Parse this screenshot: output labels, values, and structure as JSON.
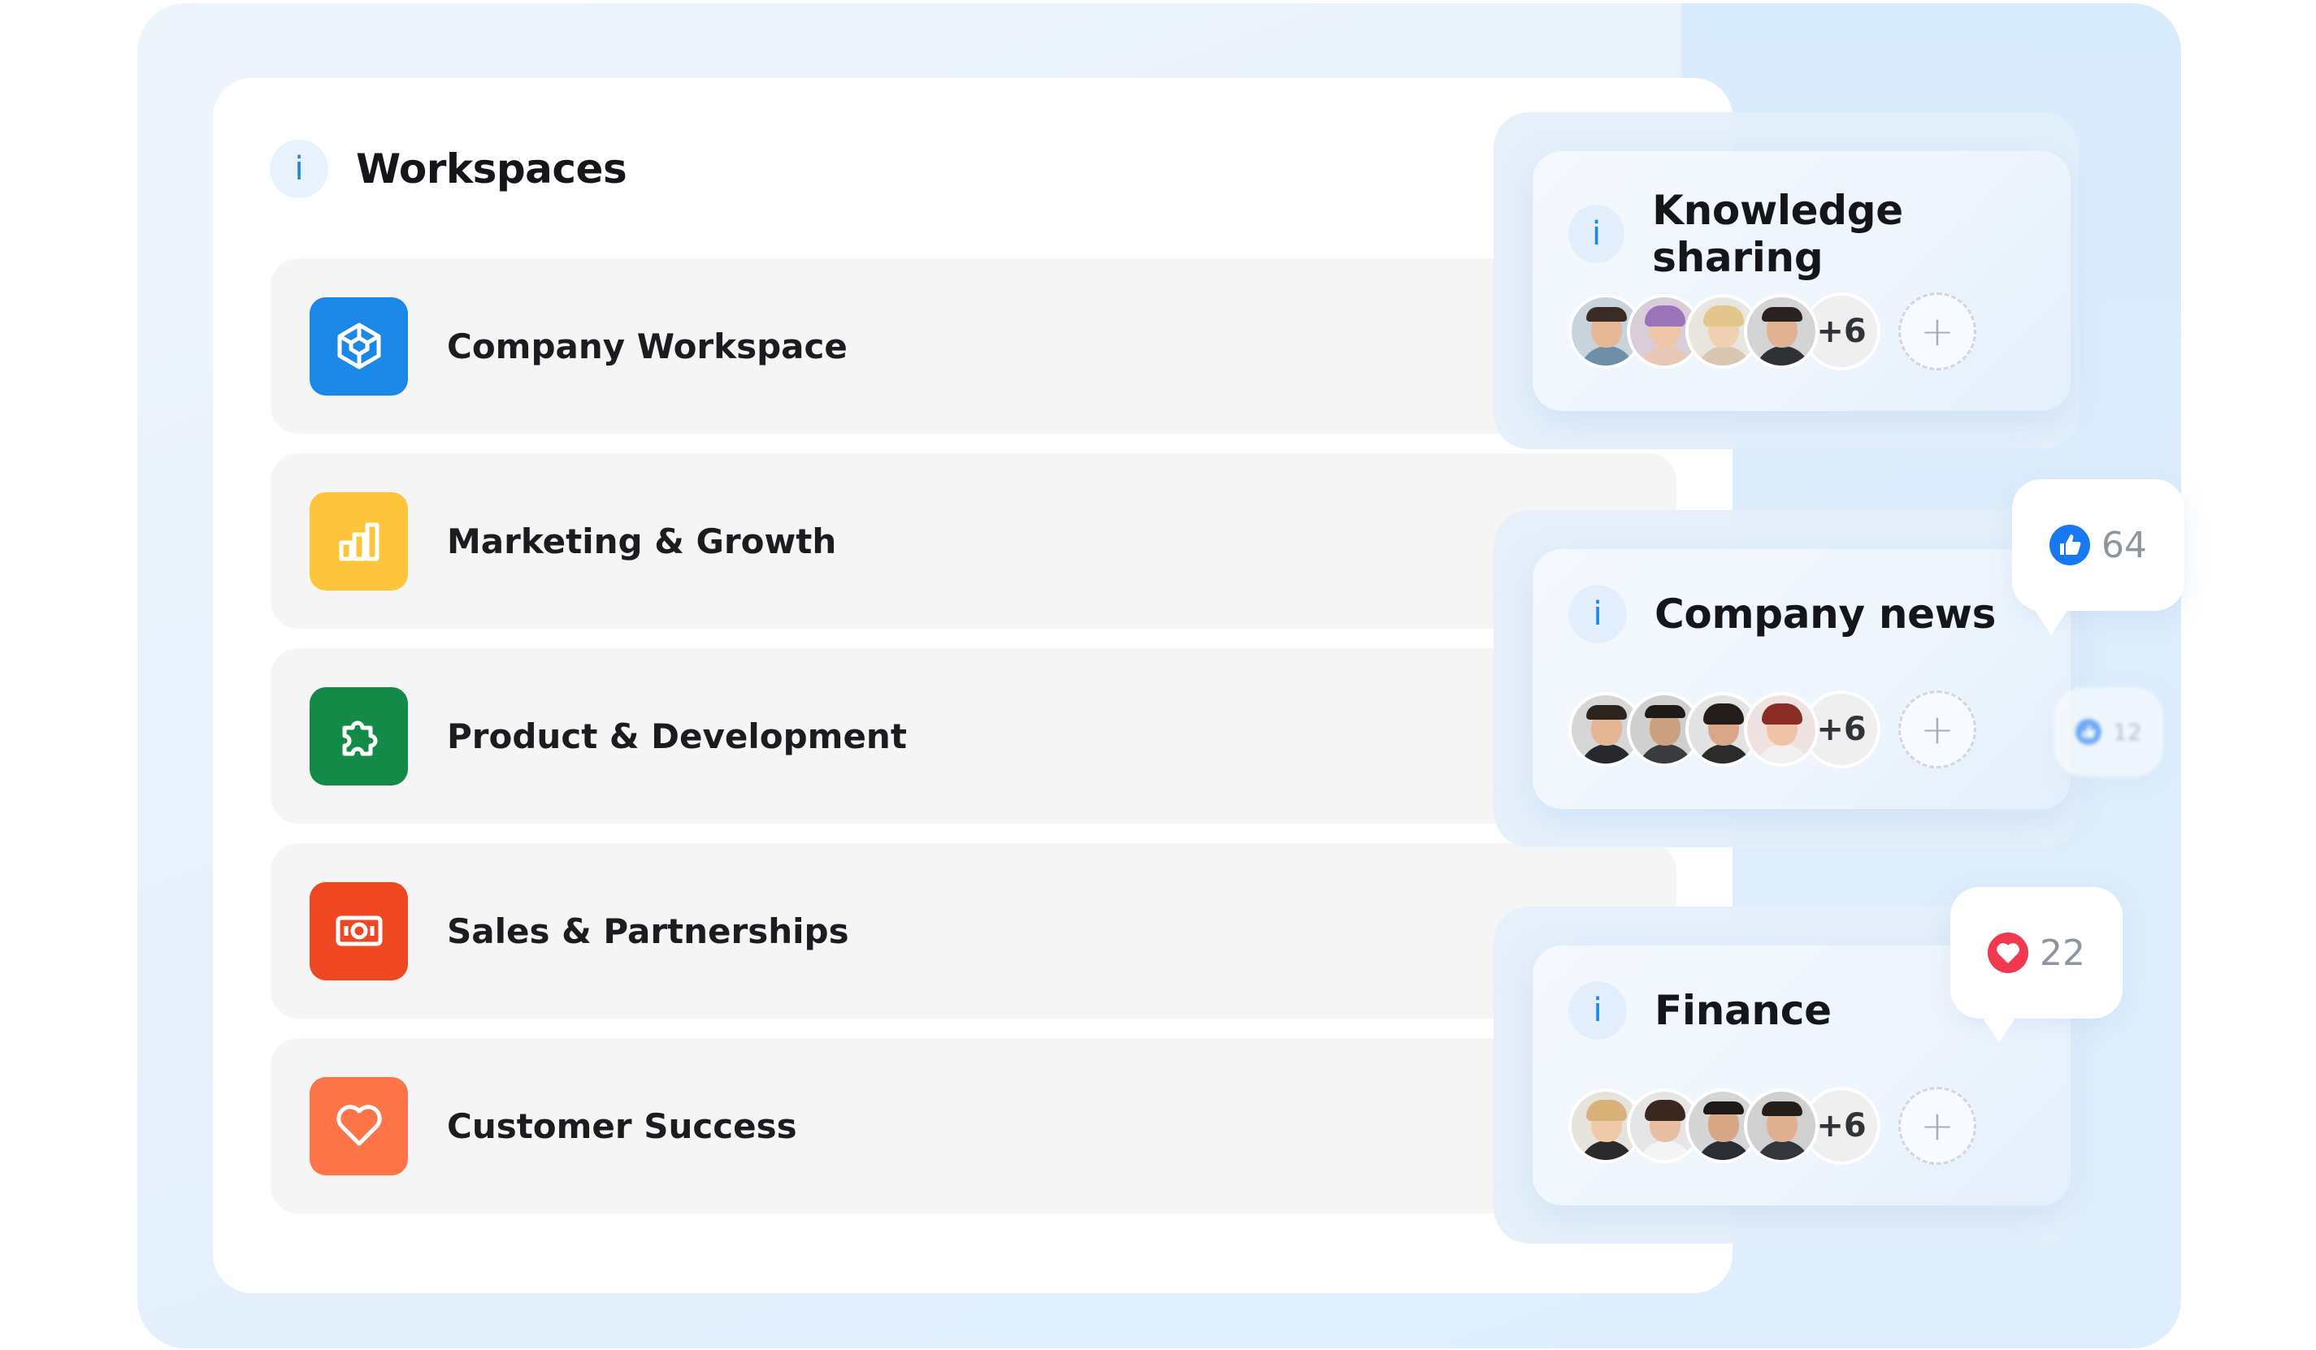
{
  "workspaces": {
    "title": "Workspaces",
    "info_label": "i",
    "items": [
      {
        "label": "Company Workspace",
        "icon": "cube-icon",
        "color": "#1B87E6"
      },
      {
        "label": "Marketing & Growth",
        "icon": "bar-chart-icon",
        "color": "#FDC43C"
      },
      {
        "label": "Product & Development",
        "icon": "puzzle-icon",
        "color": "#138A48"
      },
      {
        "label": "Sales & Partnerships",
        "icon": "cash-icon",
        "color": "#EE4722"
      },
      {
        "label": "Customer Success",
        "icon": "heart-icon",
        "color": "#FC7447"
      }
    ]
  },
  "cards": [
    {
      "title": "Knowledge sharing",
      "info_label": "i",
      "more_label": "+6",
      "add_label": "+"
    },
    {
      "title": "Company news",
      "info_label": "i",
      "more_label": "+6",
      "add_label": "+"
    },
    {
      "title": "Finance",
      "info_label": "i",
      "more_label": "+6",
      "add_label": "+"
    }
  ],
  "reactions": [
    {
      "type": "like",
      "icon": "thumbs-up-icon",
      "count": "64"
    },
    {
      "type": "like",
      "icon": "thumbs-up-icon",
      "count": "12"
    },
    {
      "type": "love",
      "icon": "heart-icon",
      "count": "22"
    }
  ],
  "colors": {
    "accent_blue": "#1C88E3",
    "like_blue": "#1877F2",
    "love_red": "#F0384F"
  }
}
